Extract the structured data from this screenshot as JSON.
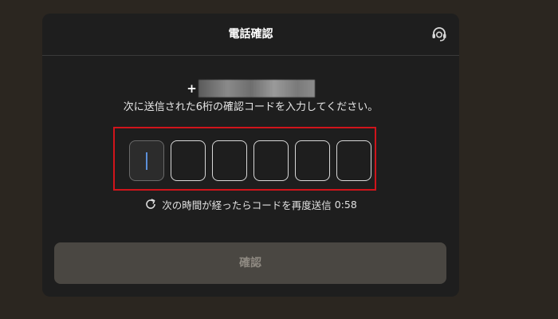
{
  "dialog": {
    "title": "電話確認"
  },
  "phone": {
    "prefix": "+"
  },
  "instruction": "次に送信された6桁の確認コードを入力してください。",
  "code": {
    "digits": [
      "",
      "",
      "",
      "",
      "",
      ""
    ]
  },
  "resend": {
    "label": "次の時間が経ったらコードを再度送信",
    "countdown": "0:58"
  },
  "confirm_button": "確認",
  "colors": {
    "highlight": "#d0141b",
    "background": "#2b2620",
    "modal": "#1e1e1e",
    "caret": "#5b8fd9"
  },
  "icons": {
    "support": "headset-icon",
    "resend": "refresh-icon"
  }
}
